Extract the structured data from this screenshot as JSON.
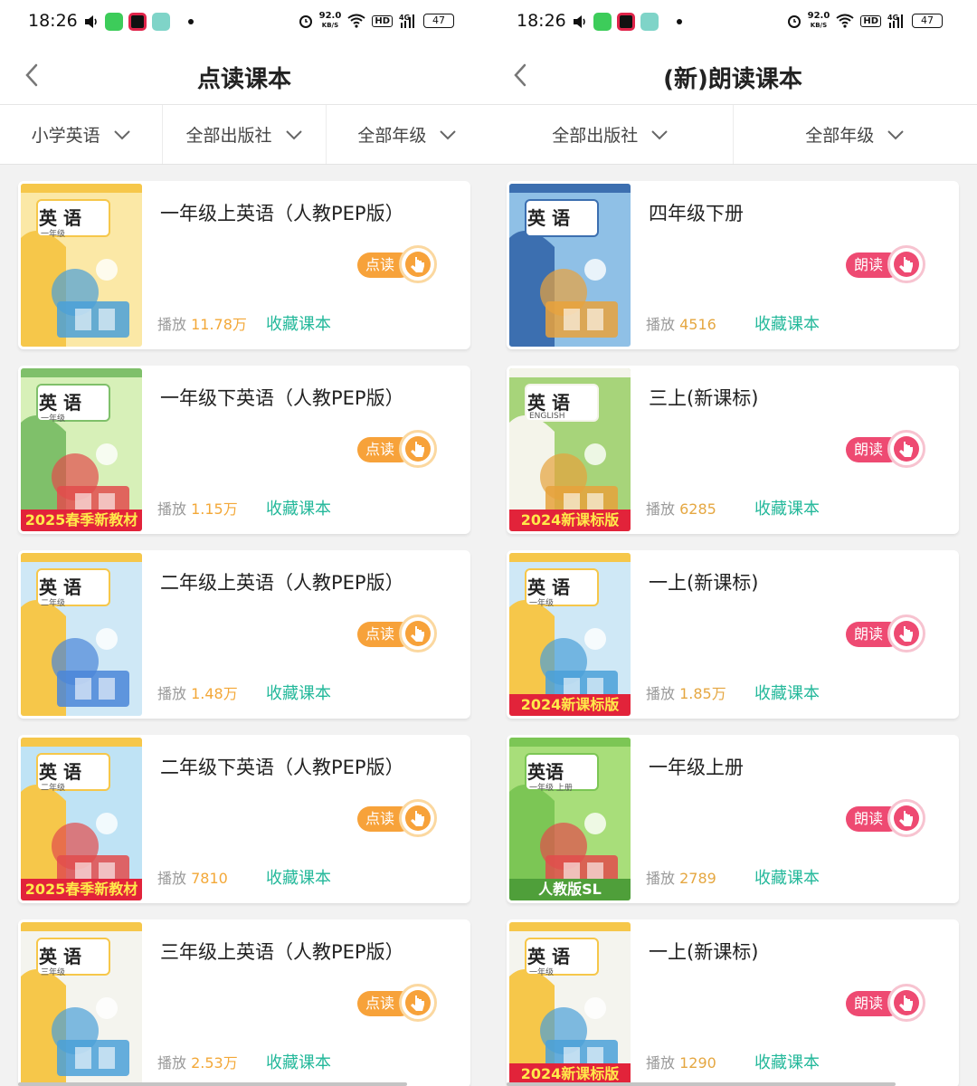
{
  "status_bar": {
    "time": "18:26",
    "net_speed": "92.0",
    "net_unit": "KB/S",
    "hd": "HD",
    "signal": "4G",
    "battery": "47"
  },
  "left": {
    "title": "点读课本",
    "filters": [
      "小学英语",
      "全部出版社",
      "全部年级"
    ],
    "play_label": "播放",
    "fav_label": "收藏课本",
    "btn_label": "点读",
    "books": [
      {
        "title": "一年级上英语（人教PEP版）",
        "plays": "11.78万",
        "cover_word": "英 语",
        "cover_grade": "一年级",
        "banner": ""
      },
      {
        "title": "一年级下英语（人教PEP版）",
        "plays": "1.15万",
        "cover_word": "英 语",
        "cover_grade": "一年级",
        "banner": "2025春季新教材"
      },
      {
        "title": "二年级上英语（人教PEP版）",
        "plays": "1.48万",
        "cover_word": "英 语",
        "cover_grade": "二年级",
        "banner": ""
      },
      {
        "title": "二年级下英语（人教PEP版）",
        "plays": "7810",
        "cover_word": "英 语",
        "cover_grade": "二年级",
        "banner": "2025春季新教材"
      },
      {
        "title": "三年级上英语（人教PEP版）",
        "plays": "2.53万",
        "cover_word": "英 语",
        "cover_grade": "三年级",
        "banner": ""
      }
    ]
  },
  "right": {
    "title": "(新)朗读课本",
    "filters": [
      "全部出版社",
      "全部年级"
    ],
    "play_label": "播放",
    "fav_label": "收藏课本",
    "btn_label": "朗读",
    "books": [
      {
        "title": "四年级下册",
        "plays": "4516",
        "cover_word": "英 语",
        "cover_grade": "",
        "banner": ""
      },
      {
        "title": "三上(新课标)",
        "plays": "6285",
        "cover_word": "英 语",
        "cover_grade": "ENGLISH",
        "banner": "2024新课标版"
      },
      {
        "title": "一上(新课标)",
        "plays": "1.85万",
        "cover_word": "英 语",
        "cover_grade": "一年级",
        "banner": "2024新课标版"
      },
      {
        "title": "一年级上册",
        "plays": "2789",
        "cover_word": "英语",
        "cover_grade": "一年级 上册",
        "banner": "人教版SL"
      },
      {
        "title": "一上(新课标)",
        "plays": "1290",
        "cover_word": "英 语",
        "cover_grade": "一年级",
        "banner": "2024新课标版"
      }
    ]
  },
  "colors": {
    "orange_btn": "#f7a23a",
    "pink_btn": "#ee4a72",
    "fav_green": "#23b89a",
    "plays_orange": "#f3a838"
  }
}
